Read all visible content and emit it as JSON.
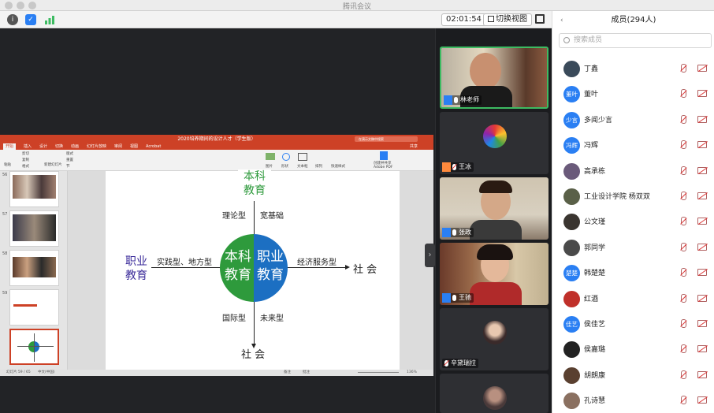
{
  "window": {
    "title": "腾讯会议"
  },
  "toolbar": {
    "timer": "02:01:54",
    "switch_view": "切换视图"
  },
  "colors": {
    "accent_green": "#3dbb62",
    "ppt_red": "#cd4126",
    "blue": "#2a7ff3",
    "mute_red": "#e53935"
  },
  "ppt": {
    "title": "2020培养期间的设计人才（学生版）",
    "search_placeholder": "在演示文稿中搜索",
    "tabs": [
      "开始",
      "插入",
      "设计",
      "切换",
      "动画",
      "幻灯片放映",
      "审阅",
      "视图",
      "Acrobat"
    ],
    "share": "共享",
    "ribbon": [
      "粘贴",
      "剪切",
      "复制",
      "格式",
      "新建幻灯片",
      "版式",
      "重置",
      "节",
      "图片",
      "形状",
      "文本框",
      "排列",
      "快速样式",
      "创建并共享 Adobe PDF"
    ],
    "slide_numbers": [
      "56",
      "57",
      "58",
      "59"
    ],
    "status_left": "幻灯片 59 / 65",
    "status_lang": "中文(中国)",
    "status_notes": "备注",
    "status_comments": "批注",
    "zoom": "136%",
    "slide": {
      "top": "本科\n教育",
      "left": "职业\n教育",
      "circle_left": "本科\n教育",
      "circle_right": "职业\n教育",
      "label_tl": "理论型",
      "label_tr": "宽基础",
      "label_ml": "实践型、地方型",
      "label_mr": "经济服务型",
      "label_bl": "国际型",
      "label_br": "未来型",
      "right": "社 会",
      "bottom": "社 会"
    }
  },
  "videos": [
    {
      "name": "林老师",
      "active": true
    },
    {
      "name": "王冰",
      "active": false
    },
    {
      "name": "张政",
      "active": false
    },
    {
      "name": "王驰",
      "active": false
    },
    {
      "name": "辛黛瑞拉",
      "active": false
    }
  ],
  "members": {
    "title": "成员(294人)",
    "search_placeholder": "搜索成员",
    "list": [
      {
        "name": "丁鑫",
        "avatar_text": "",
        "color": "#3a4a5a"
      },
      {
        "name": "董叶",
        "avatar_text": "董叶",
        "color": "#2a7ff3"
      },
      {
        "name": "多闻少言",
        "avatar_text": "少言",
        "color": "#2a7ff3"
      },
      {
        "name": "冯辉",
        "avatar_text": "冯辉",
        "color": "#2a7ff3"
      },
      {
        "name": "高承栋",
        "avatar_text": "",
        "color": "#6a5a7a"
      },
      {
        "name": "工业设计学院 杨双双",
        "avatar_text": "",
        "color": "#5a6048"
      },
      {
        "name": "公文瑾",
        "avatar_text": "",
        "color": "#3a3530"
      },
      {
        "name": "郭同学",
        "avatar_text": "",
        "color": "#4a4a4a"
      },
      {
        "name": "韩楚楚",
        "avatar_text": "楚楚",
        "color": "#2a7ff3"
      },
      {
        "name": "红酒",
        "avatar_text": "",
        "color": "#c0302a"
      },
      {
        "name": "侯佳艺",
        "avatar_text": "佳艺",
        "color": "#2a7ff3"
      },
      {
        "name": "侯嘉璐",
        "avatar_text": "",
        "color": "#222"
      },
      {
        "name": "胡朗康",
        "avatar_text": "",
        "color": "#5a4030"
      },
      {
        "name": "孔诗慧",
        "avatar_text": "",
        "color": "#8a7060"
      }
    ]
  }
}
